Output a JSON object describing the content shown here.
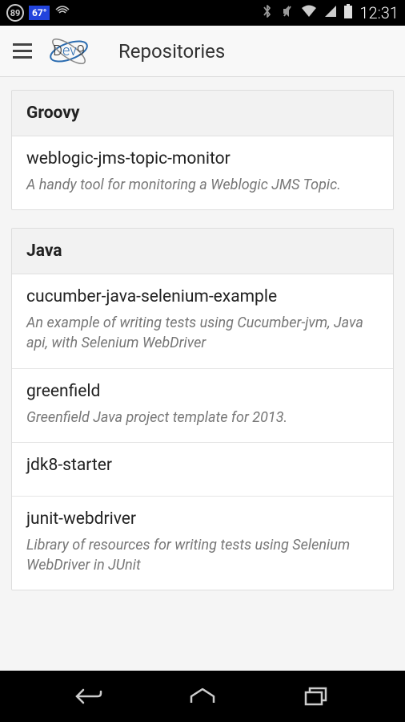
{
  "statusBar": {
    "badge": "89",
    "temp": "67°",
    "clock": "12:31"
  },
  "header": {
    "logo": "Dev9",
    "title": "Repositories"
  },
  "sections": [
    {
      "title": "Groovy",
      "repos": [
        {
          "name": "weblogic-jms-topic-monitor",
          "desc": "A handy tool for monitoring a Weblogic JMS Topic."
        }
      ]
    },
    {
      "title": "Java",
      "repos": [
        {
          "name": "cucumber-java-selenium-example",
          "desc": "An example of writing tests using Cucumber-jvm, Java api, with Selenium WebDriver"
        },
        {
          "name": "greenfield",
          "desc": "Greenfield Java project template for 2013."
        },
        {
          "name": "jdk8-starter",
          "desc": ""
        },
        {
          "name": "junit-webdriver",
          "desc": "Library of resources for writing tests using Selenium WebDriver in JUnit"
        }
      ]
    }
  ]
}
